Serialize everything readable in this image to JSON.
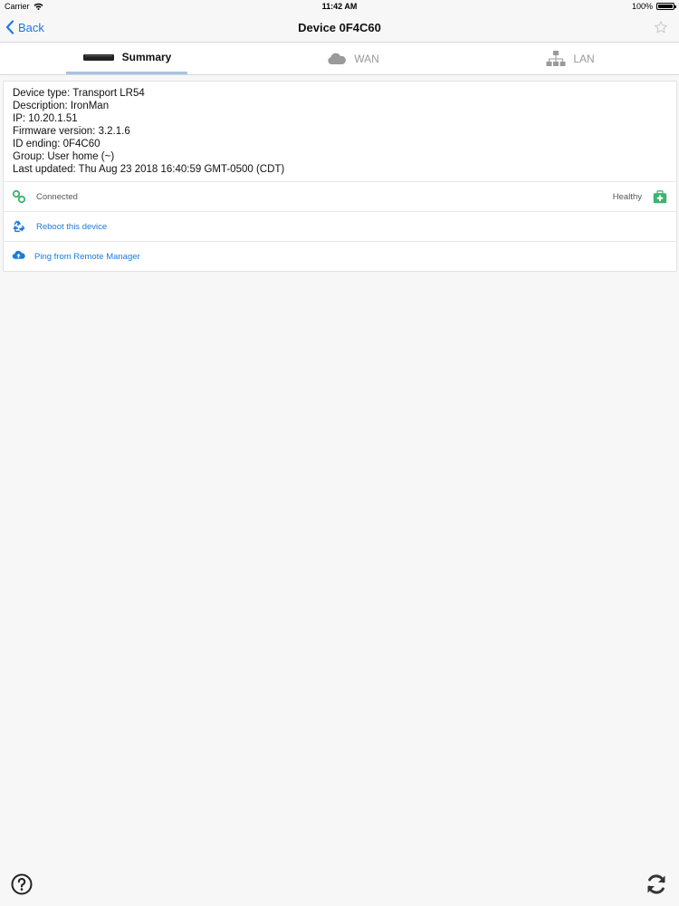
{
  "status_bar": {
    "carrier": "Carrier",
    "time": "11:42 AM",
    "battery": "100%"
  },
  "nav": {
    "back_label": "Back",
    "title": "Device 0F4C60"
  },
  "tabs": [
    {
      "label": "Summary",
      "icon": "router-icon"
    },
    {
      "label": "WAN",
      "icon": "cloud-icon"
    },
    {
      "label": "LAN",
      "icon": "network-icon"
    }
  ],
  "details": [
    "Device type: Transport LR54",
    "Description: IronMan",
    "IP: 10.20.1.51",
    "Firmware version: 3.2.1.6",
    "ID ending: 0F4C60",
    "Group: User home (~)",
    "Last updated: Thu Aug 23 2018 16:40:59 GMT-0500 (CDT)"
  ],
  "rows": {
    "connection": "Connected",
    "health": "Healthy",
    "reboot": "Reboot this device",
    "ping": "Ping from Remote Manager"
  },
  "colors": {
    "accent": "#1a7be0",
    "healthy": "#3cb46e",
    "tab_underline": "#a9c3df"
  }
}
